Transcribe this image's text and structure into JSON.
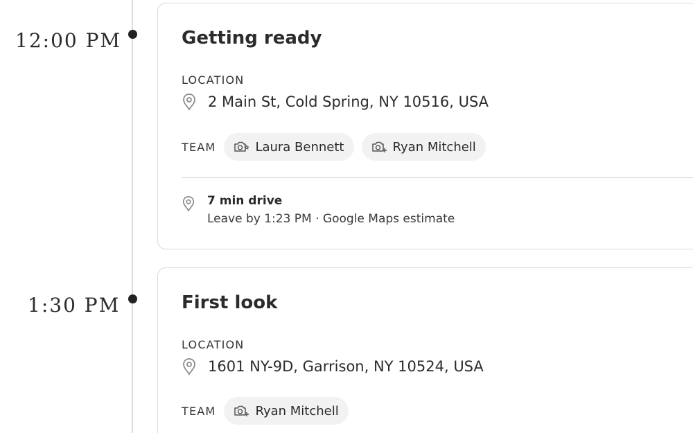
{
  "events": [
    {
      "time": "12:00 PM",
      "title": "Getting ready",
      "location_label": "LOCATION",
      "location": "2 Main St, Cold Spring, NY 10516, USA",
      "team_label": "TEAM",
      "team": [
        {
          "name": "Laura Bennett",
          "icon": "camera-star-icon"
        },
        {
          "name": "Ryan Mitchell",
          "icon": "camera-plus-icon"
        }
      ],
      "drive": {
        "title": "7 min drive",
        "subtitle": "Leave by 1:23 PM · Google Maps estimate"
      }
    },
    {
      "time": "1:30 PM",
      "title": "First look",
      "location_label": "LOCATION",
      "location": "1601 NY-9D, Garrison, NY 10524, USA",
      "team_label": "TEAM",
      "team": [
        {
          "name": "Ryan Mitchell",
          "icon": "camera-plus-icon"
        }
      ]
    }
  ],
  "colors": {
    "text": "#2b2b2b",
    "card_border": "#d9d9d9",
    "chip_bg": "#f2f2f2",
    "timeline": "#dcdcdc",
    "dot": "#222222"
  }
}
